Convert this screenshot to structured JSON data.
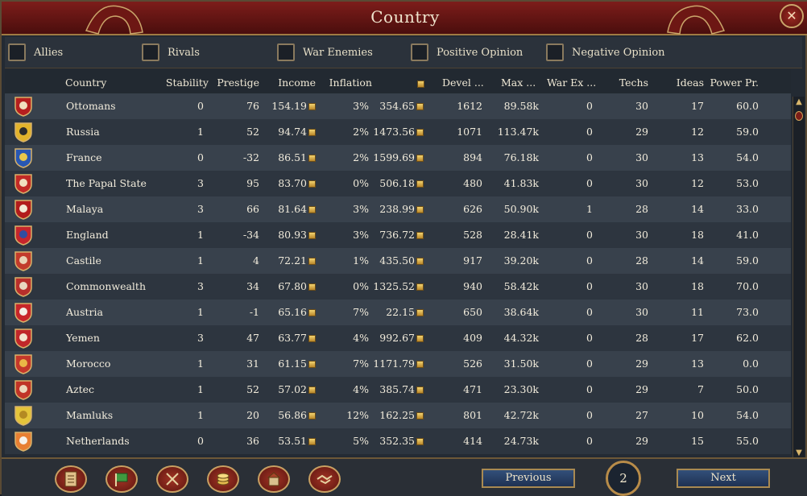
{
  "window": {
    "title": "Country"
  },
  "filters": [
    {
      "label": "Allies",
      "checked": false
    },
    {
      "label": "Rivals",
      "checked": false
    },
    {
      "label": "War Enemies",
      "checked": false
    },
    {
      "label": "Positive Opinion",
      "checked": false
    },
    {
      "label": "Negative Opinion",
      "checked": false
    }
  ],
  "columns": [
    "Country",
    "Stability",
    "Prestige",
    "Income",
    "Inflation",
    "",
    "Devel ...",
    "Max  ...",
    "War Ex ...",
    "Techs",
    "Ideas",
    "Power Pr."
  ],
  "rows": [
    {
      "country": "Ottomans",
      "stability": "0",
      "prestige": "76",
      "income": "154.19",
      "inflation": "3%",
      "treasury": "354.65",
      "devel": "1612",
      "max": "89.58k",
      "warex": "0",
      "techs": "30",
      "ideas": "17",
      "power": "60.0",
      "flag": "ottoman-flag-icon"
    },
    {
      "country": "Russia",
      "stability": "1",
      "prestige": "52",
      "income": "94.74",
      "inflation": "2%",
      "treasury": "1473.56",
      "devel": "1071",
      "max": "113.47k",
      "warex": "0",
      "techs": "29",
      "ideas": "12",
      "power": "59.0",
      "flag": "russia-flag-icon"
    },
    {
      "country": "France",
      "stability": "0",
      "prestige": "-32",
      "income": "86.51",
      "inflation": "2%",
      "treasury": "1599.69",
      "devel": "894",
      "max": "76.18k",
      "warex": "0",
      "techs": "30",
      "ideas": "13",
      "power": "54.0",
      "flag": "france-flag-icon"
    },
    {
      "country": "The Papal State",
      "stability": "3",
      "prestige": "95",
      "income": "83.70",
      "inflation": "0%",
      "treasury": "506.18",
      "devel": "480",
      "max": "41.83k",
      "warex": "0",
      "techs": "30",
      "ideas": "12",
      "power": "53.0",
      "flag": "papal-state-flag-icon"
    },
    {
      "country": "Malaya",
      "stability": "3",
      "prestige": "66",
      "income": "81.64",
      "inflation": "3%",
      "treasury": "238.99",
      "devel": "626",
      "max": "50.90k",
      "warex": "1",
      "techs": "28",
      "ideas": "14",
      "power": "33.0",
      "flag": "malaya-flag-icon"
    },
    {
      "country": "England",
      "stability": "1",
      "prestige": "-34",
      "income": "80.93",
      "inflation": "3%",
      "treasury": "736.72",
      "devel": "528",
      "max": "28.41k",
      "warex": "0",
      "techs": "30",
      "ideas": "18",
      "power": "41.0",
      "flag": "england-flag-icon"
    },
    {
      "country": "Castile",
      "stability": "1",
      "prestige": "4",
      "income": "72.21",
      "inflation": "1%",
      "treasury": "435.50",
      "devel": "917",
      "max": "39.20k",
      "warex": "0",
      "techs": "28",
      "ideas": "14",
      "power": "59.0",
      "flag": "castile-flag-icon"
    },
    {
      "country": "Commonwealth",
      "stability": "3",
      "prestige": "34",
      "income": "67.80",
      "inflation": "0%",
      "treasury": "1325.52",
      "devel": "940",
      "max": "58.42k",
      "warex": "0",
      "techs": "30",
      "ideas": "18",
      "power": "70.0",
      "flag": "commonwealth-flag-icon"
    },
    {
      "country": "Austria",
      "stability": "1",
      "prestige": "-1",
      "income": "65.16",
      "inflation": "7%",
      "treasury": "22.15",
      "devel": "650",
      "max": "38.64k",
      "warex": "0",
      "techs": "30",
      "ideas": "11",
      "power": "73.0",
      "flag": "austria-flag-icon"
    },
    {
      "country": "Yemen",
      "stability": "3",
      "prestige": "47",
      "income": "63.77",
      "inflation": "4%",
      "treasury": "992.67",
      "devel": "409",
      "max": "44.32k",
      "warex": "0",
      "techs": "28",
      "ideas": "17",
      "power": "62.0",
      "flag": "yemen-flag-icon"
    },
    {
      "country": "Morocco",
      "stability": "1",
      "prestige": "31",
      "income": "61.15",
      "inflation": "7%",
      "treasury": "1171.79",
      "devel": "526",
      "max": "31.50k",
      "warex": "0",
      "techs": "29",
      "ideas": "13",
      "power": "0.0",
      "flag": "morocco-flag-icon"
    },
    {
      "country": "Aztec",
      "stability": "1",
      "prestige": "52",
      "income": "57.02",
      "inflation": "4%",
      "treasury": "385.74",
      "devel": "471",
      "max": "23.30k",
      "warex": "0",
      "techs": "29",
      "ideas": "7",
      "power": "50.0",
      "flag": "aztec-flag-icon"
    },
    {
      "country": "Mamluks",
      "stability": "1",
      "prestige": "20",
      "income": "56.86",
      "inflation": "12%",
      "treasury": "162.25",
      "devel": "801",
      "max": "42.72k",
      "warex": "0",
      "techs": "27",
      "ideas": "10",
      "power": "54.0",
      "flag": "mamluks-flag-icon"
    },
    {
      "country": "Netherlands",
      "stability": "0",
      "prestige": "36",
      "income": "53.51",
      "inflation": "5%",
      "treasury": "352.35",
      "devel": "414",
      "max": "24.73k",
      "warex": "0",
      "techs": "29",
      "ideas": "15",
      "power": "55.0",
      "flag": "netherlands-flag-icon"
    }
  ],
  "bottom": {
    "buttons": [
      "ledger-icon",
      "flag-icon",
      "swords-icon",
      "coins-icon",
      "buildings-icon",
      "handshake-icon"
    ],
    "previous_label": "Previous",
    "next_label": "Next",
    "page": "2"
  },
  "colors": {
    "title_bg": "#7d1d1a",
    "gold": "#c9a56a",
    "nav_blue": "#2b4570"
  }
}
